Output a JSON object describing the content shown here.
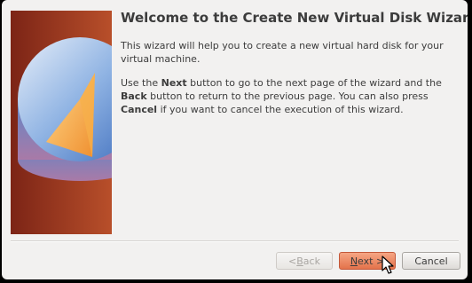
{
  "wizard": {
    "title": "Welcome to the Create New Virtual Disk Wizard!",
    "intro": "This wizard will help you to create a new virtual hard disk for your virtual machine.",
    "instructions": {
      "p1": "Use the ",
      "next_word": "Next",
      "p2": " button to go to the next page of the wizard and the ",
      "back_word": "Back",
      "p3": " button to return to the previous page. You can also press ",
      "cancel_word": "Cancel",
      "p4": " if you want to cancel the execution of this wizard."
    }
  },
  "buttons": {
    "back": {
      "prefix": "< ",
      "mnemonic": "B",
      "rest": "ack"
    },
    "next": {
      "mnemonic": "N",
      "rest": "ext >"
    },
    "cancel": "Cancel"
  },
  "colors": {
    "side_panel": "#a8462a",
    "next_button": "#e4734b"
  },
  "icons": {
    "side_image": "virtual-disk-icon",
    "cursor": "mouse-pointer-icon"
  }
}
